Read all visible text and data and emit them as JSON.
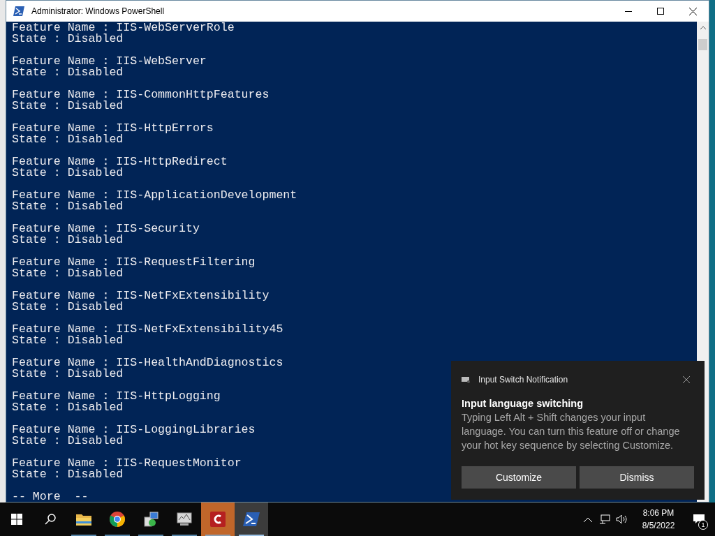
{
  "window": {
    "title": "Administrator: Windows PowerShell"
  },
  "console": {
    "entries": [
      {
        "name_line": "Feature Name : IIS-WebServerRole",
        "state_line": "State : Disabled"
      },
      {
        "name_line": "Feature Name : IIS-WebServer",
        "state_line": "State : Disabled"
      },
      {
        "name_line": "Feature Name : IIS-CommonHttpFeatures",
        "state_line": "State : Disabled"
      },
      {
        "name_line": "Feature Name : IIS-HttpErrors",
        "state_line": "State : Disabled"
      },
      {
        "name_line": "Feature Name : IIS-HttpRedirect",
        "state_line": "State : Disabled"
      },
      {
        "name_line": "Feature Name : IIS-ApplicationDevelopment",
        "state_line": "State : Disabled"
      },
      {
        "name_line": "Feature Name : IIS-Security",
        "state_line": "State : Disabled"
      },
      {
        "name_line": "Feature Name : IIS-RequestFiltering",
        "state_line": "State : Disabled"
      },
      {
        "name_line": "Feature Name : IIS-NetFxExtensibility",
        "state_line": "State : Disabled"
      },
      {
        "name_line": "Feature Name : IIS-NetFxExtensibility45",
        "state_line": "State : Disabled"
      },
      {
        "name_line": "Feature Name : IIS-HealthAndDiagnostics",
        "state_line": "State : Disabled"
      },
      {
        "name_line": "Feature Name : IIS-HttpLogging",
        "state_line": "State : Disabled"
      },
      {
        "name_line": "Feature Name : IIS-LoggingLibraries",
        "state_line": "State : Disabled"
      },
      {
        "name_line": "Feature Name : IIS-RequestMonitor",
        "state_line": "State : Disabled"
      }
    ],
    "prompt": "-- More  --"
  },
  "notification": {
    "app": "Input Switch Notification",
    "title": "Input language switching",
    "body": "Typing Left Alt + Shift changes your input language. You can turn this feature off or change your hot key sequence by selecting Customize.",
    "buttons": [
      "Customize",
      "Dismiss"
    ]
  },
  "taskbar": {
    "apps": [
      {
        "kind": "folder",
        "selected": false
      },
      {
        "kind": "chrome",
        "selected": false
      },
      {
        "kind": "installer",
        "selected": false
      },
      {
        "kind": "monitor",
        "selected": false
      },
      {
        "kind": "redapp",
        "selected": false
      },
      {
        "kind": "powershell",
        "selected": true
      }
    ],
    "time": "8:06 PM",
    "date": "8/5/2022",
    "notification_count": "1"
  }
}
